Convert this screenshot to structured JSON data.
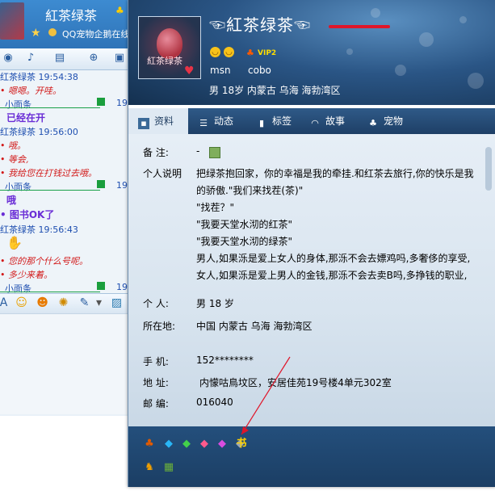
{
  "chat_window": {
    "title_name": "紅茶绿茶",
    "subtitle": "QQ宠物企鹅在线",
    "messages": [
      {
        "type": "sender",
        "text": "红茶绿茶  19:54:38"
      },
      {
        "type": "text",
        "text": "• 嗯嗯。开哇。"
      },
      {
        "type": "divider_name",
        "text": "小面条"
      },
      {
        "type": "big",
        "text": "已经在开"
      },
      {
        "type": "sender",
        "text": "红茶绿茶  19:56:00"
      },
      {
        "type": "text",
        "text": "• 哦。"
      },
      {
        "type": "text",
        "text": "• 等会,"
      },
      {
        "type": "text",
        "text": "• 我给您在打钱过去哦。"
      },
      {
        "type": "divider_name",
        "text": "小面条"
      },
      {
        "type": "big",
        "text": "哦"
      },
      {
        "type": "big",
        "text": "• 图书OK了"
      },
      {
        "type": "sender",
        "text": "红茶绿茶  19:56:43"
      },
      {
        "type": "text",
        "text": "• 您的那个什么号呢。"
      },
      {
        "type": "text",
        "text": "• 多少来着。"
      },
      {
        "type": "divider_name",
        "text": "小面条"
      }
    ],
    "side_number": "19"
  },
  "profile": {
    "nickname": "☜紅茶绿茶☜",
    "vip": "VIP2",
    "msn": "msn",
    "cobo": "cobo",
    "basic": "男    18岁    内蒙古 乌海 海勃湾区",
    "tabs": [
      {
        "label": "资料",
        "icon": "profile-card-icon"
      },
      {
        "label": "动态",
        "icon": "list-icon"
      },
      {
        "label": "标签",
        "icon": "bookmark-icon"
      },
      {
        "label": "故事",
        "icon": "wifi-signal-icon"
      },
      {
        "label": "宠物",
        "icon": "pet-penguin-icon"
      }
    ],
    "remark_label": "备    注:",
    "remark_value": "-",
    "signature_label": "个人说明",
    "signature_lines": [
      "把绿茶抱回家，你的幸福是我的牵挂.和红茶去旅行,你的快乐是我",
      "的骄傲.\"我们来找茬(茶)\"",
      "\"找茬？\"",
      "\"我要天堂水沏的红茶\"",
      "\"我要天堂水沏的绿茶\"",
      "男人,如果泺是爱上女人的身体,那泺不会去嫖鸡吗,多奢侈的享受,",
      "女人,如果泺是爱上男人的金钱,那泺不会去卖B吗,多挣钱的职业,"
    ],
    "personal_label": "个    人:",
    "personal_value": "男    18 岁",
    "location_label": "所在地:",
    "location_value": "中国 内蒙古 乌海 海勃湾区",
    "phone_label": "手    机:",
    "phone_value": "152********",
    "address_label": "地    址:",
    "address_value": "内懞咕鳥坟区，安居佳苑19号楼4单元302室",
    "zip_label": "邮    编:",
    "zip_value": "016040",
    "avatar_text": "紅茶绿茶"
  },
  "colors": {
    "header_dark": "#14304f",
    "tab_bar": "#2f5a88",
    "body_bg": "#e6eef6",
    "annotation_red": "#e0162a"
  }
}
